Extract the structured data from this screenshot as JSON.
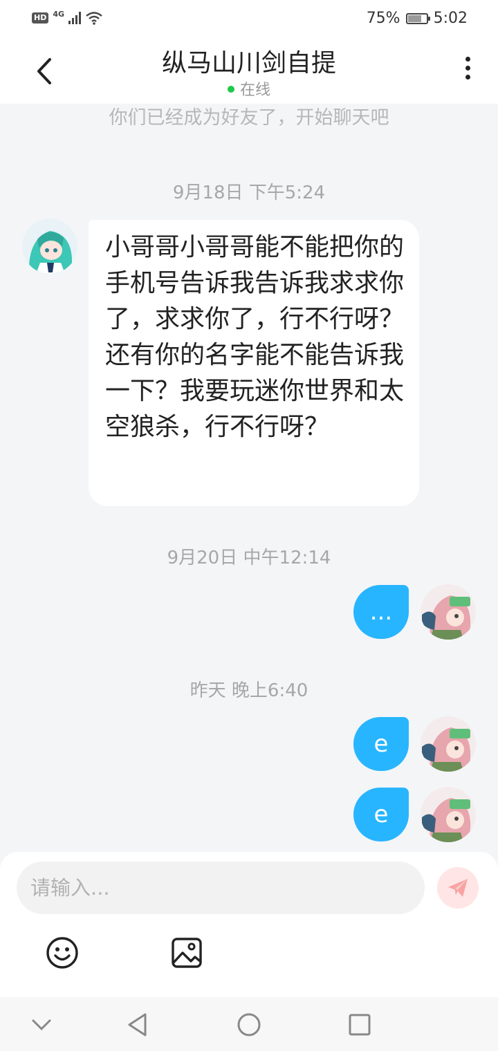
{
  "status_bar": {
    "hd": "HD",
    "network": "4G",
    "battery_text": "75%",
    "battery_level": 0.75,
    "time": "5:02"
  },
  "header": {
    "back_icon": "chevron-left-icon",
    "title": "纵马山川剑自提",
    "status": "在线",
    "status_color": "#1fc94a",
    "more_icon": "more-vertical-icon"
  },
  "chat": {
    "system_note": "你们已经成为好友了，开始聊天吧",
    "groups": [
      {
        "timestamp": "9月18日 下午5:24",
        "messages": [
          {
            "side": "incoming",
            "text": "小哥哥小哥哥能不能把你的手机号告诉我告诉我求求你了，求求你了，行不行呀？还有你的名字能不能告诉我一下？我要玩迷你世界和太空狼杀，行不行呀？"
          }
        ]
      },
      {
        "timestamp": "9月20日 中午12:14",
        "messages": [
          {
            "side": "outgoing",
            "text": "..."
          }
        ]
      },
      {
        "timestamp": "昨天 晚上6:40",
        "messages": [
          {
            "side": "outgoing",
            "text": "e"
          },
          {
            "side": "outgoing",
            "text": "e"
          }
        ]
      }
    ]
  },
  "input": {
    "placeholder": "请输入...",
    "value": "",
    "send_icon": "paper-plane-icon",
    "tools": [
      "smiley-face-icon",
      "image-icon"
    ]
  },
  "nav": {
    "icons": [
      "chevron-down-icon",
      "back-triangle-icon",
      "home-circle-icon",
      "recents-square-icon"
    ]
  },
  "colors": {
    "outgoing_bubble": "#28b5ff",
    "background": "#f4f5f7",
    "send_button_bg": "#ffe5e5",
    "send_button_icon": "#f7a3a3"
  }
}
